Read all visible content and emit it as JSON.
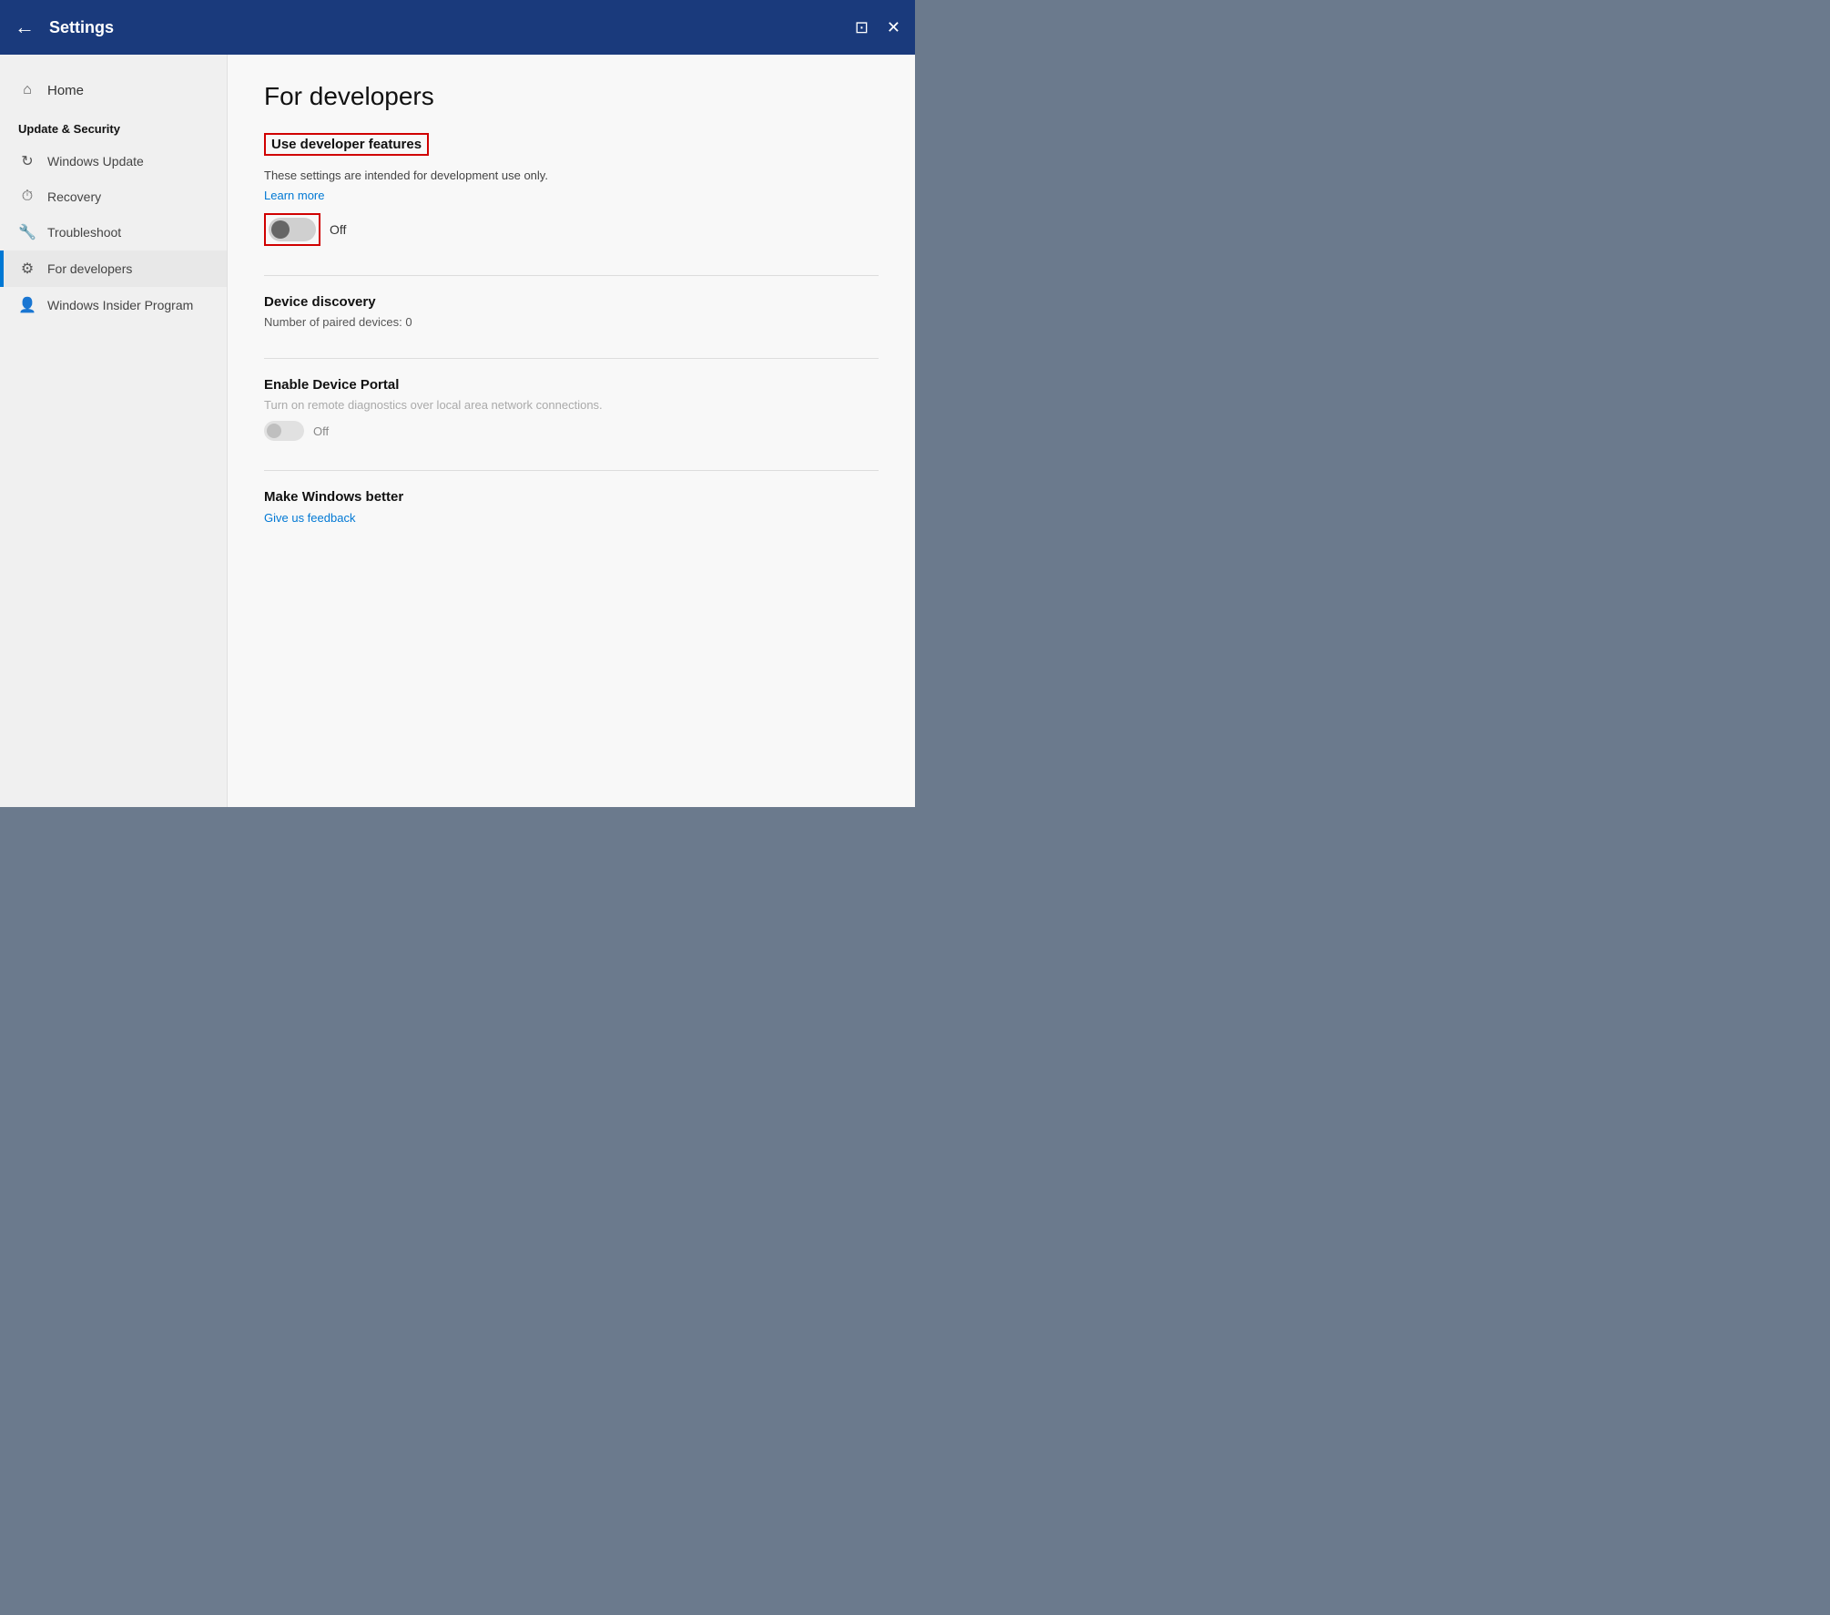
{
  "titlebar": {
    "back_label": "←",
    "title": "Settings",
    "snap_icon": "⊡",
    "close_icon": "✕"
  },
  "sidebar": {
    "home_label": "Home",
    "section_title": "Update & Security",
    "items": [
      {
        "id": "windows-update",
        "label": "Windows Update",
        "icon": "↻"
      },
      {
        "id": "recovery",
        "label": "Recovery",
        "icon": "⏱"
      },
      {
        "id": "troubleshoot",
        "label": "Troubleshoot",
        "icon": "🔧"
      },
      {
        "id": "for-developers",
        "label": "For developers",
        "icon": "⚙",
        "active": true
      },
      {
        "id": "windows-insider",
        "label": "Windows Insider Program",
        "icon": "👤"
      }
    ]
  },
  "content": {
    "page_title": "For developers",
    "use_developer": {
      "heading": "Use developer features",
      "description": "These settings are intended for development use only.",
      "learn_more": "Learn more",
      "toggle_state": "Off"
    },
    "device_discovery": {
      "heading": "Device discovery",
      "paired_devices": "Number of paired devices: 0"
    },
    "enable_device_portal": {
      "heading": "Enable Device Portal",
      "description": "Turn on remote diagnostics over local area network connections.",
      "toggle_state": "Off"
    },
    "make_windows_better": {
      "heading": "Make Windows better",
      "feedback_link": "Give us feedback"
    }
  }
}
